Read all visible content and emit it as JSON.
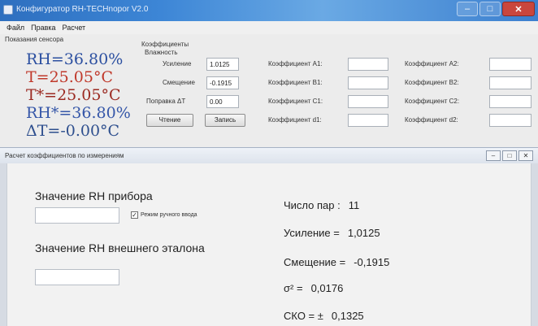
{
  "window": {
    "title": "Конфигуратор RH-TECHnopor V2.0",
    "minimize_glyph": "–",
    "maximize_glyph": "□",
    "close_glyph": "✕"
  },
  "menu": [
    "Файл",
    "Правка",
    "Расчет"
  ],
  "sensor": {
    "group_title": "Показания сенсора",
    "readings": [
      {
        "text": "RH=36.80%",
        "color": "#2b4fa0"
      },
      {
        "text": "T=25.05°C",
        "color": "#c0392b"
      },
      {
        "text": "T*=25.05°C",
        "color": "#9b2a22"
      },
      {
        "text": "RH*=36.80%",
        "color": "#3556a8"
      },
      {
        "text": "ΔT=-0.00°C",
        "color": "#2e4f8e"
      }
    ]
  },
  "coefficients": {
    "group_title": "Коэффициенты",
    "humidity_title": "Влажность",
    "gain_label": "Усиление",
    "gain_value": "1.0125",
    "offset_label": "Смещение",
    "offset_value": "-0.1915",
    "dt_label": "Поправка ΔT",
    "dt_value": "0.00",
    "read_button": "Чтение",
    "write_button": "Запись",
    "a1_label": "Коэффициент A1:",
    "b1_label": "Коэффициент B1:",
    "c1_label": "Коэффициент C1:",
    "d1_label": "Коэффициент d1:",
    "a2_label": "Коэффициент A2:",
    "b2_label": "Коэффициент B2:",
    "c2_label": "Коэффициент C2:",
    "d2_label": "Коэффициент d2:"
  },
  "child_window": {
    "title": "Расчет коэффициентов по измерениям",
    "device_rh_label": "Значение RH прибора",
    "manual_mode_label": "Режим ручного ввода",
    "manual_mode_checked": true,
    "external_rh_label": "Значение RH внешнего эталона",
    "pairs_label": "Число пар :",
    "pairs_value": "11",
    "gain_label": "Усиление =",
    "gain_value": "1,0125",
    "offset_label": "Смещение =",
    "offset_value": "-0,1915",
    "sigma_label": "σ² =",
    "sigma_value": "0,0176",
    "sko_label": "СКО = ±",
    "sko_value": "0,1325"
  }
}
